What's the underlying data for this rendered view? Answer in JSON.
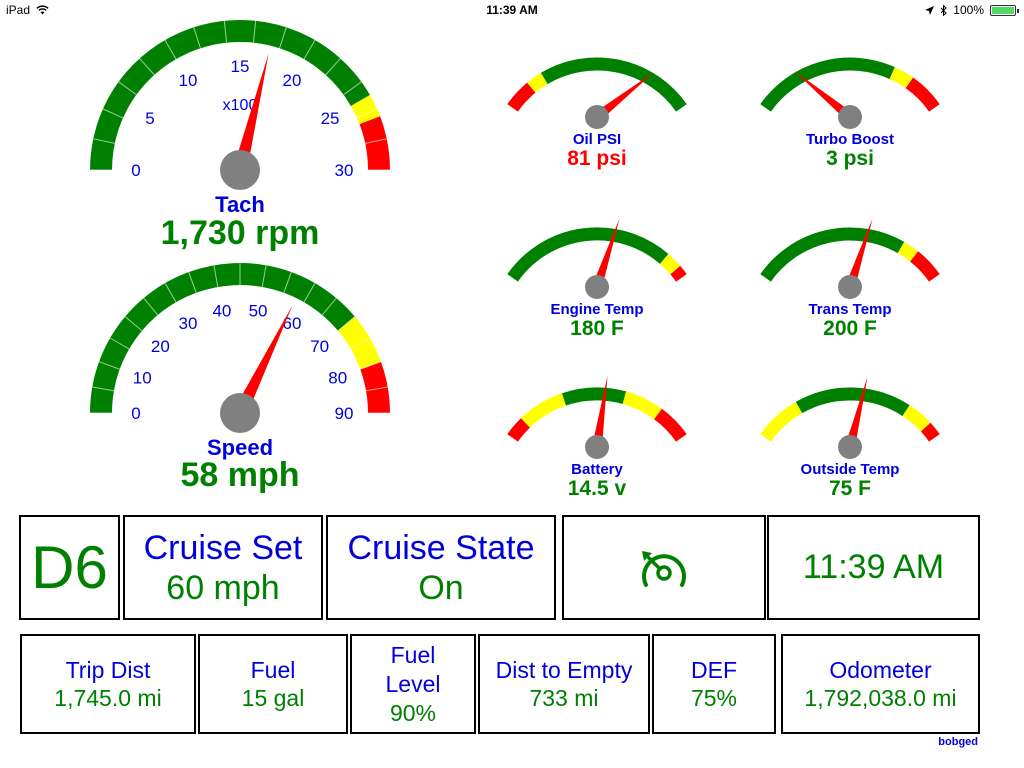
{
  "status_bar": {
    "device": "iPad",
    "wifi_icon": "wifi-icon",
    "time": "11:39 AM",
    "location_icon": "location-arrow-icon",
    "bluetooth_icon": "bluetooth-icon",
    "battery_percent": "100%",
    "battery_level": 1.0
  },
  "colors": {
    "green": "#008000",
    "yellow": "#ffff00",
    "red": "#ff0000",
    "label_blue": "#0000dd",
    "needle": "#ff0000",
    "hub": "#808080"
  },
  "large_gauges": [
    {
      "key": "tach",
      "label": "Tach",
      "value_text": "1,730 rpm",
      "unit_label": "x100",
      "value": 17.3,
      "min": 0,
      "max": 30,
      "ticks": [
        "0",
        "5",
        "10",
        "15",
        "20",
        "25",
        "30"
      ],
      "tick_values": [
        0,
        5,
        10,
        15,
        20,
        25,
        30
      ],
      "zones": [
        {
          "from": 0,
          "to": 25,
          "color": "green"
        },
        {
          "from": 25,
          "to": 26.5,
          "color": "yellow"
        },
        {
          "from": 26.5,
          "to": 30,
          "color": "red"
        }
      ]
    },
    {
      "key": "speed",
      "label": "Speed",
      "value_text": "58 mph",
      "value": 58,
      "min": 0,
      "max": 90,
      "ticks": [
        "0",
        "10",
        "20",
        "30",
        "40",
        "50",
        "60",
        "70",
        "80",
        "90"
      ],
      "tick_values": [
        0,
        10,
        20,
        30,
        40,
        50,
        60,
        70,
        80,
        90
      ],
      "zones": [
        {
          "from": 0,
          "to": 70,
          "color": "green"
        },
        {
          "from": 70,
          "to": 80,
          "color": "yellow"
        },
        {
          "from": 80,
          "to": 90,
          "color": "red"
        }
      ]
    }
  ],
  "small_gauges": [
    {
      "key": "oil-psi",
      "label": "Oil PSI",
      "value_text": "81 psi",
      "value_color": "red",
      "needle_fraction": 0.87,
      "zones": [
        {
          "from": 0,
          "to": 0.14,
          "color": "red"
        },
        {
          "from": 0.14,
          "to": 0.22,
          "color": "yellow"
        },
        {
          "from": 0.22,
          "to": 1,
          "color": "green"
        }
      ]
    },
    {
      "key": "turbo-boost",
      "label": "Turbo Boost",
      "value_text": "3 psi",
      "value_color": "green",
      "needle_fraction": 0.14,
      "zones": [
        {
          "from": 0,
          "to": 0.72,
          "color": "green"
        },
        {
          "from": 0.72,
          "to": 0.82,
          "color": "yellow"
        },
        {
          "from": 0.82,
          "to": 1,
          "color": "red"
        }
      ]
    },
    {
      "key": "engine-temp",
      "label": "Engine Temp",
      "value_text": "180 F",
      "value_color": "green",
      "needle_fraction": 0.63,
      "zones": [
        {
          "from": 0,
          "to": 0.87,
          "color": "green"
        },
        {
          "from": 0.87,
          "to": 0.95,
          "color": "yellow"
        },
        {
          "from": 0.95,
          "to": 1,
          "color": "red"
        }
      ]
    },
    {
      "key": "trans-temp",
      "label": "Trans Temp",
      "value_text": "200 F",
      "value_color": "green",
      "needle_fraction": 0.63,
      "zones": [
        {
          "from": 0,
          "to": 0.77,
          "color": "green"
        },
        {
          "from": 0.77,
          "to": 0.85,
          "color": "yellow"
        },
        {
          "from": 0.85,
          "to": 1,
          "color": "red"
        }
      ]
    },
    {
      "key": "battery",
      "label": "Battery",
      "value_text": "14.5 v",
      "value_color": "green",
      "needle_fraction": 0.56,
      "zones": [
        {
          "from": 0,
          "to": 0.1,
          "color": "red"
        },
        {
          "from": 0.1,
          "to": 0.33,
          "color": "yellow"
        },
        {
          "from": 0.33,
          "to": 0.64,
          "color": "green"
        },
        {
          "from": 0.64,
          "to": 0.83,
          "color": "yellow"
        },
        {
          "from": 0.83,
          "to": 1,
          "color": "red"
        }
      ]
    },
    {
      "key": "outside-temp",
      "label": "Outside Temp",
      "value_text": "75 F",
      "value_color": "green",
      "needle_fraction": 0.6,
      "zones": [
        {
          "from": 0,
          "to": 0.23,
          "color": "yellow"
        },
        {
          "from": 0.23,
          "to": 0.8,
          "color": "green"
        },
        {
          "from": 0.8,
          "to": 0.93,
          "color": "yellow"
        },
        {
          "from": 0.93,
          "to": 1,
          "color": "red"
        }
      ]
    }
  ],
  "status_tiles": {
    "gear": "D6",
    "cruise_set_label": "Cruise Set",
    "cruise_set_value": "60 mph",
    "cruise_state_label": "Cruise State",
    "cruise_state_value": "On",
    "cruise_icon": "cruise-control-icon",
    "clock": "11:39 AM"
  },
  "info_tiles": [
    {
      "key": "trip-dist",
      "label": "Trip Dist",
      "value": "1,745.0 mi"
    },
    {
      "key": "fuel",
      "label": "Fuel",
      "value": "15 gal"
    },
    {
      "key": "fuel-level",
      "label": "Fuel Level",
      "value": "90%"
    },
    {
      "key": "dist-to-empty",
      "label": "Dist to Empty",
      "value": "733 mi"
    },
    {
      "key": "def",
      "label": "DEF",
      "value": "75%"
    },
    {
      "key": "odometer",
      "label": "Odometer",
      "value": "1,792,038.0 mi"
    }
  ],
  "footer": "bobged"
}
